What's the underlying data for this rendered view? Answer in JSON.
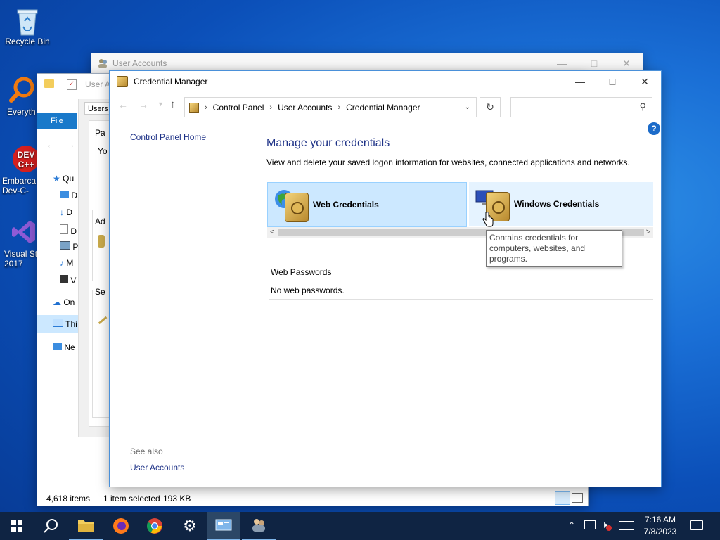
{
  "desktop": {
    "icons": [
      {
        "label": "Recycle Bin",
        "icon": "recycle-bin-icon"
      },
      {
        "label": "Everyth",
        "icon": "everything-search-icon"
      },
      {
        "label": "Embarca\nDev-C-",
        "icon": "devcpp-icon"
      },
      {
        "label": "Visual St\n2017",
        "icon": "visual-studio-icon"
      }
    ]
  },
  "back_window_user_accounts": {
    "title": "User Accounts"
  },
  "explorer_window": {
    "title": "User A",
    "ribbon_tab_file": "File",
    "tab_users": "Users",
    "left_frag_pa": "Pa",
    "left_frag_yo": "Yo",
    "left_frag_ad": "Ad",
    "left_frag_se": "Se",
    "nav_items": [
      "Qu",
      "D",
      "D",
      "D",
      "P",
      "M",
      "V",
      "On",
      "Thi",
      "Ne"
    ],
    "status_items": "4,618 items",
    "status_selected": "1 item selected",
    "status_size": "193 KB"
  },
  "credential_manager": {
    "title": "Credential Manager",
    "breadcrumb": [
      "Control Panel",
      "User Accounts",
      "Credential Manager"
    ],
    "search_placeholder": "",
    "sidebar_home": "Control Panel Home",
    "see_also_label": "See also",
    "see_also_link": "User Accounts",
    "heading": "Manage your credentials",
    "description": "View and delete your saved logon information for websites, connected applications and networks.",
    "tile_web": "Web Credentials",
    "tile_windows": "Windows Credentials",
    "tooltip": "Contains credentials for computers, websites, and programs.",
    "section_header": "Web Passwords",
    "section_empty": "No web passwords.",
    "help_glyph": "?"
  },
  "taskbar": {
    "time": "7:16 AM",
    "date": "7/8/2023"
  },
  "colors": {
    "accent": "#0078d7",
    "heading_blue": "#1e3287",
    "tile_selected": "#cce8ff",
    "taskbar": "#0f2443"
  }
}
